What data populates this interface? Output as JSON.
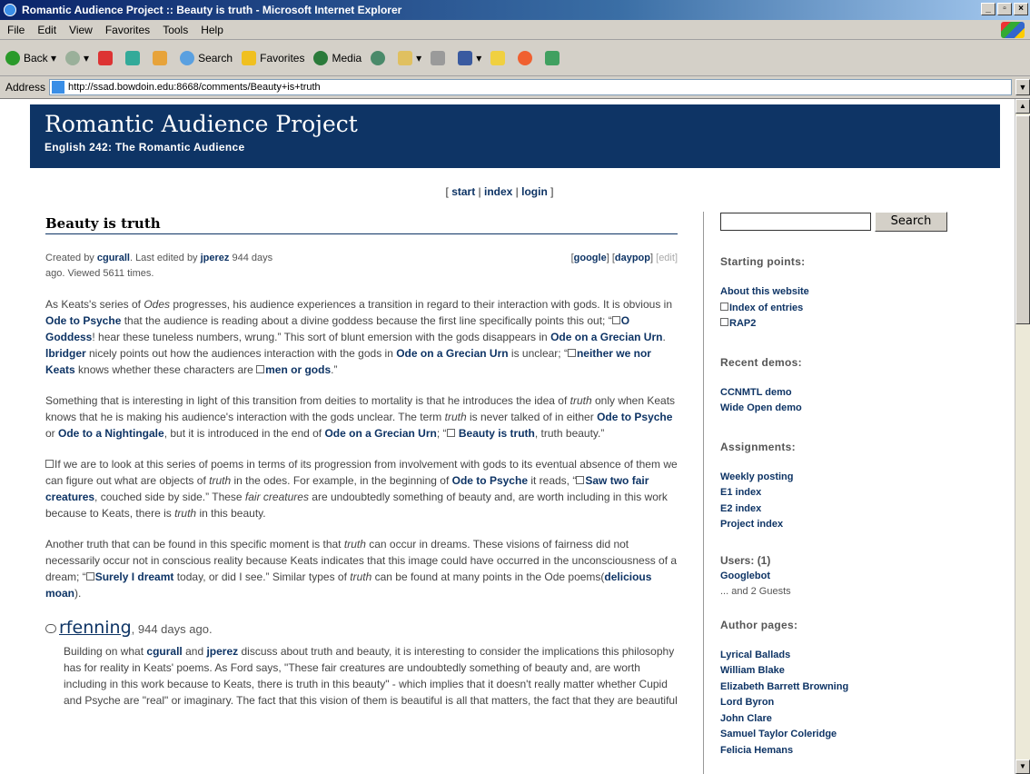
{
  "window": {
    "title": "Romantic Audience Project :: Beauty is truth - Microsoft Internet Explorer"
  },
  "menu": [
    "File",
    "Edit",
    "View",
    "Favorites",
    "Tools",
    "Help"
  ],
  "toolbar": {
    "back": "Back",
    "search": "Search",
    "favorites": "Favorites",
    "media": "Media"
  },
  "address": {
    "label": "Address",
    "url": "http://ssad.bowdoin.edu:8668/comments/Beauty+is+truth"
  },
  "site": {
    "title": "Romantic Audience Project",
    "subtitle": "English 242: The Romantic Audience"
  },
  "nav": {
    "start": "start",
    "index": "index",
    "login": "login"
  },
  "entry": {
    "title": "Beauty is truth",
    "created_by_label": "Created by",
    "created_by": "cgurall",
    "edited_by_label": ". Last edited by",
    "edited_by": "jperez",
    "age": "944 days",
    "age2": "ago. Viewed 5611 times.",
    "google": "google",
    "daypop": "daypop",
    "edit": "edit"
  },
  "paragraphs": {
    "p1": {
      "t1": "As Keats's series of ",
      "i1": "Odes",
      "t2": " progresses, his audience experiences a transition in regard to their interaction with gods. It is obvious in ",
      "b1": "Ode to Psyche",
      "t3": " that the audience is reading about a divine goddess because the first line specifically points this out; “",
      "b2": "O Goddess",
      "t4": "! hear these tuneless numbers, wrung.” This sort of blunt emersion with the gods disappears in ",
      "b3": "Ode on a Grecian Urn",
      "t5": ". ",
      "b4": "lbridger",
      "t6": " nicely points out how the audiences interaction with the gods in ",
      "b5": "Ode on a Grecian Urn",
      "t7": " is unclear; “",
      "b6": "neither we nor Keats",
      "t8": " knows whether these characters are ",
      "b7": "men or gods",
      "t9": ".”"
    },
    "p2": {
      "t1": "Something that is interesting in light of this transition from deities to mortality is that he introduces the idea of ",
      "i1": "truth",
      "t2": " only when Keats knows that he is making his audience's interaction with the gods unclear. The term ",
      "i2": "truth",
      "t3": " is never talked of in either ",
      "b1": "Ode to Psyche",
      "t4": " or ",
      "b2": "Ode to a Nightingale",
      "t5": ", but it is introduced in the end of ",
      "b3": "Ode on a Grecian Urn",
      "t6": "; “",
      "b4": "Beauty is truth",
      "t7": ", truth beauty.”"
    },
    "p3": {
      "t1": "If we are to look at this series of poems in terms of its progression from involvement with gods to its eventual absence of them we can figure out what are objects of ",
      "i1": "truth",
      "t2": " in the odes. For example, in the beginning of ",
      "b1": "Ode to Psyche",
      "t3": " it reads, “",
      "b2": "Saw two fair creatures",
      "t4": ", couched side by side.” These ",
      "i2": "fair creatures",
      "t5": " are undoubtedly something of beauty and, are worth including in this work because to Keats, there is ",
      "i3": "truth",
      "t6": " in this beauty."
    },
    "p4": {
      "t1": "Another truth that can be found in this specific moment is that ",
      "i1": "truth",
      "t2": " can occur in dreams. These visions of fairness did not necessarily occur not in conscious reality because Keats indicates that this image could have occurred in the unconsciousness of a dream; “",
      "b1": "Surely I dreamt",
      "t3": " today, or did I see.” Similar types of ",
      "i2": "truth",
      "t4": " can be found at many points in the Ode poems(",
      "b2": "delicious moan",
      "t5": ")."
    }
  },
  "comment": {
    "author": "rfenning",
    "age": ", 944 days ago.",
    "t1": "Building on what ",
    "b1": "cgurall",
    "t2": " and ",
    "b2": "jperez",
    "t3": " discuss about truth and beauty, it is interesting to consider the implications this philosophy has for reality in Keats' poems. As Ford says, \"These fair creatures are undoubtedly something of beauty and, are worth including in this work because to Keats, there is truth in this beauty\" - which implies that it doesn't really matter whether Cupid and Psyche are \"real\" or imaginary. The fact that this vision of them is beautiful is all that matters, the fact that they are beautiful"
  },
  "sidebar": {
    "search_button": "Search",
    "starting_points_heading": "Starting points:",
    "starting_points": [
      "About this website",
      "Index of entries",
      "RAP2"
    ],
    "recent_demos_heading": "Recent demos:",
    "recent_demos": [
      "CCNMTL demo",
      "Wide Open demo"
    ],
    "assignments_heading": "Assignments:",
    "assignments": [
      "Weekly posting",
      "E1 index",
      "E2 index",
      "Project index"
    ],
    "users_heading": "Users: (1)",
    "users": [
      "Googlebot"
    ],
    "guests": "... and 2 Guests",
    "author_pages_heading": "Author pages:",
    "author_pages": [
      "Lyrical Ballads",
      "William Blake",
      "Elizabeth Barrett Browning",
      "Lord Byron",
      "John Clare",
      "Samuel Taylor Coleridge",
      "Felicia Hemans"
    ]
  },
  "colors": {
    "header_bg": "#0e3465",
    "link": "#0e3465",
    "titlebar": "#0a246a"
  }
}
